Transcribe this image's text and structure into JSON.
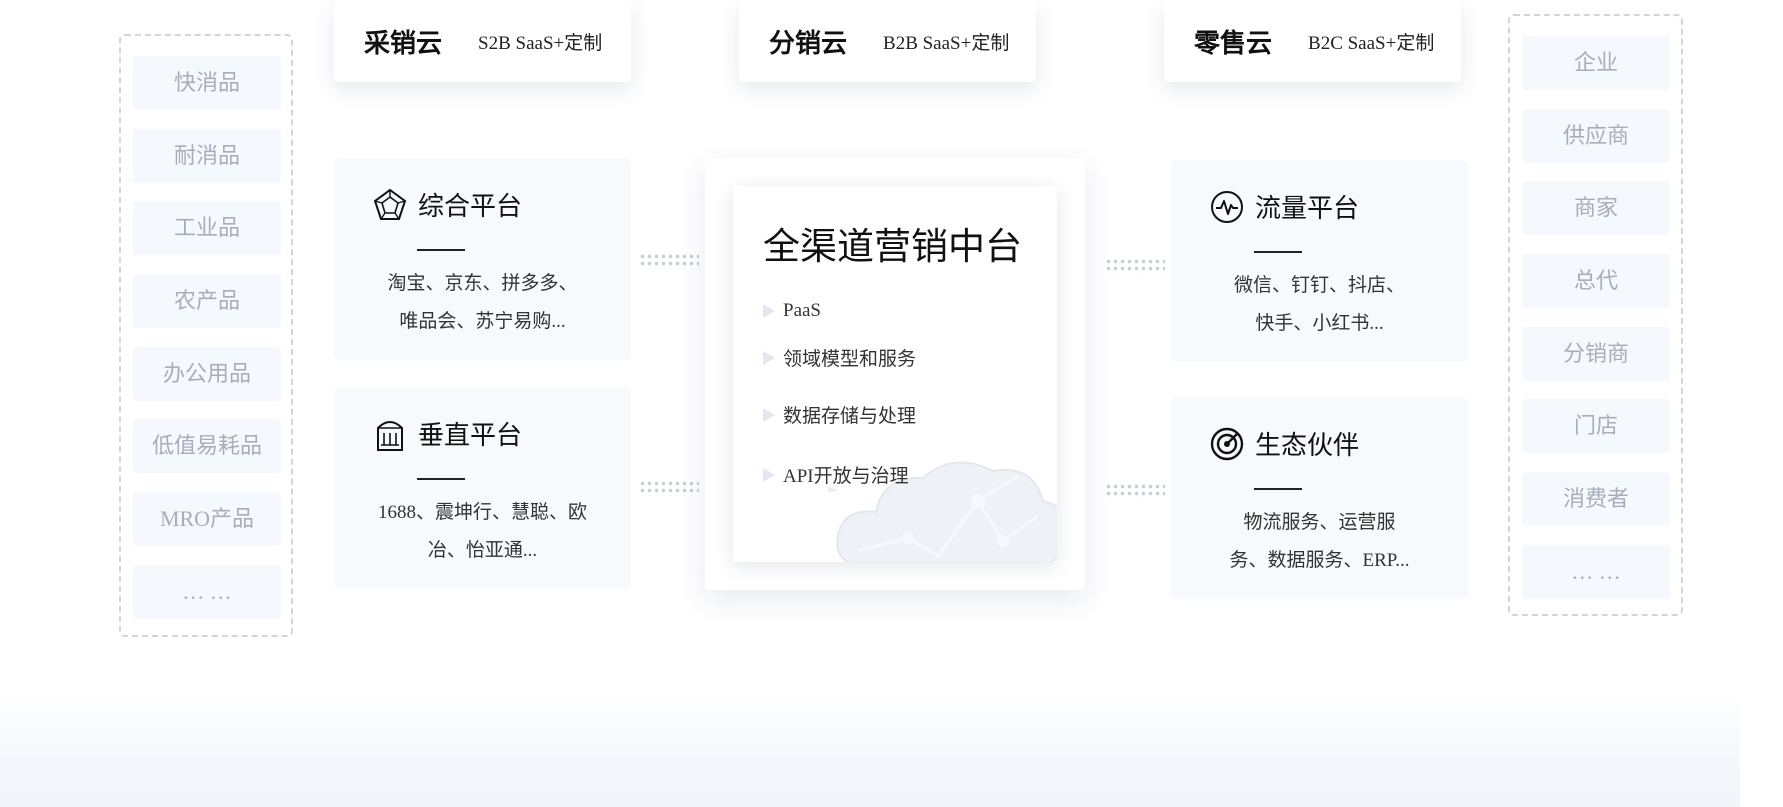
{
  "left_categories": [
    "快消品",
    "耐消品",
    "工业品",
    "农产品",
    "办公用品",
    "低值易耗品",
    "MRO产品",
    "… …"
  ],
  "right_roles": [
    "企业",
    "供应商",
    "商家",
    "总代",
    "分销商",
    "门店",
    "消费者",
    "… …"
  ],
  "top_clouds": [
    {
      "title": "采销云",
      "sub": "S2B SaaS+定制"
    },
    {
      "title": "分销云",
      "sub": "B2B SaaS+定制"
    },
    {
      "title": "零售云",
      "sub": "B2C SaaS+定制"
    }
  ],
  "panels": {
    "comprehensive": {
      "title": "综合平台",
      "desc_line1": "淘宝、京东、拼多多、",
      "desc_line2": "唯品会、苏宁易购..."
    },
    "vertical": {
      "title": "垂直平台",
      "desc_line1": "1688、震坤行、慧聪、欧",
      "desc_line2": "冶、怡亚通..."
    },
    "traffic": {
      "title": "流量平台",
      "desc_line1": "微信、钉钉、抖店、",
      "desc_line2": "快手、小红书..."
    },
    "ecosystem": {
      "title": "生态伙伴",
      "desc_line1": "物流服务、运营服",
      "desc_line2": "务、数据服务、ERP..."
    }
  },
  "center": {
    "title": "全渠道营销中台",
    "items": [
      "PaaS",
      "领域模型和服务",
      "数据存储与处理",
      "API开放与治理"
    ]
  },
  "icons": {
    "comprehensive": "pentagon-web-icon",
    "vertical": "building-icon",
    "traffic": "pulse-icon",
    "ecosystem": "target-icon"
  },
  "colors": {
    "panel_bg": "#f7f9fd",
    "chip_bg": "#f5f8fd",
    "chip_text": "#a7aeba",
    "dashed_border": "#d5d5d5"
  }
}
